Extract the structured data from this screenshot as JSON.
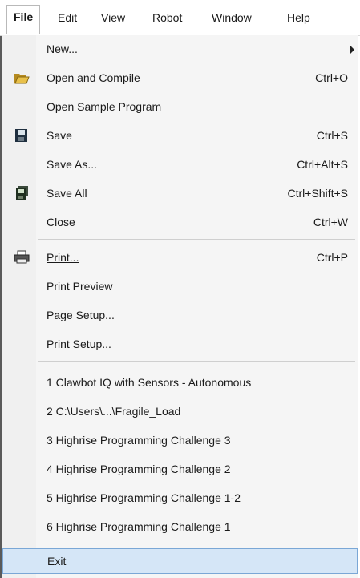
{
  "menubar": {
    "items": [
      "File",
      "Edit",
      "View",
      "Robot",
      "Window",
      "Help"
    ]
  },
  "menu": {
    "new_label": "New...",
    "open_compile_label": "Open and Compile",
    "open_compile_shortcut": "Ctrl+O",
    "open_sample_label": "Open Sample Program",
    "save_label": "Save",
    "save_shortcut": "Ctrl+S",
    "save_as_label": "Save As...",
    "save_as_shortcut": "Ctrl+Alt+S",
    "save_all_label": "Save All",
    "save_all_shortcut": "Ctrl+Shift+S",
    "close_label": "Close",
    "close_shortcut": "Ctrl+W",
    "print_label": "Print...",
    "print_shortcut": "Ctrl+P",
    "print_preview_label": "Print Preview",
    "page_setup_label": "Page Setup...",
    "print_setup_label": "Print Setup...",
    "recent_files": [
      "1 Clawbot IQ with Sensors - Autonomous",
      "2 C:\\Users\\...\\Fragile_Load",
      "3 Highrise Programming Challenge 3",
      "4 Highrise Programming Challenge 2",
      "5 Highrise Programming Challenge 1-2",
      "6 Highrise Programming Challenge 1"
    ],
    "exit_label": "Exit"
  },
  "colors": {
    "highlight": "#d5e6f7",
    "highlight_border": "#7aa7d6",
    "menu_bg": "#f5f5f5"
  },
  "icons": {
    "open_compile": "open-folder-icon",
    "save": "floppy-disk-icon",
    "save_all": "multi-floppy-icon",
    "print": "printer-icon"
  }
}
